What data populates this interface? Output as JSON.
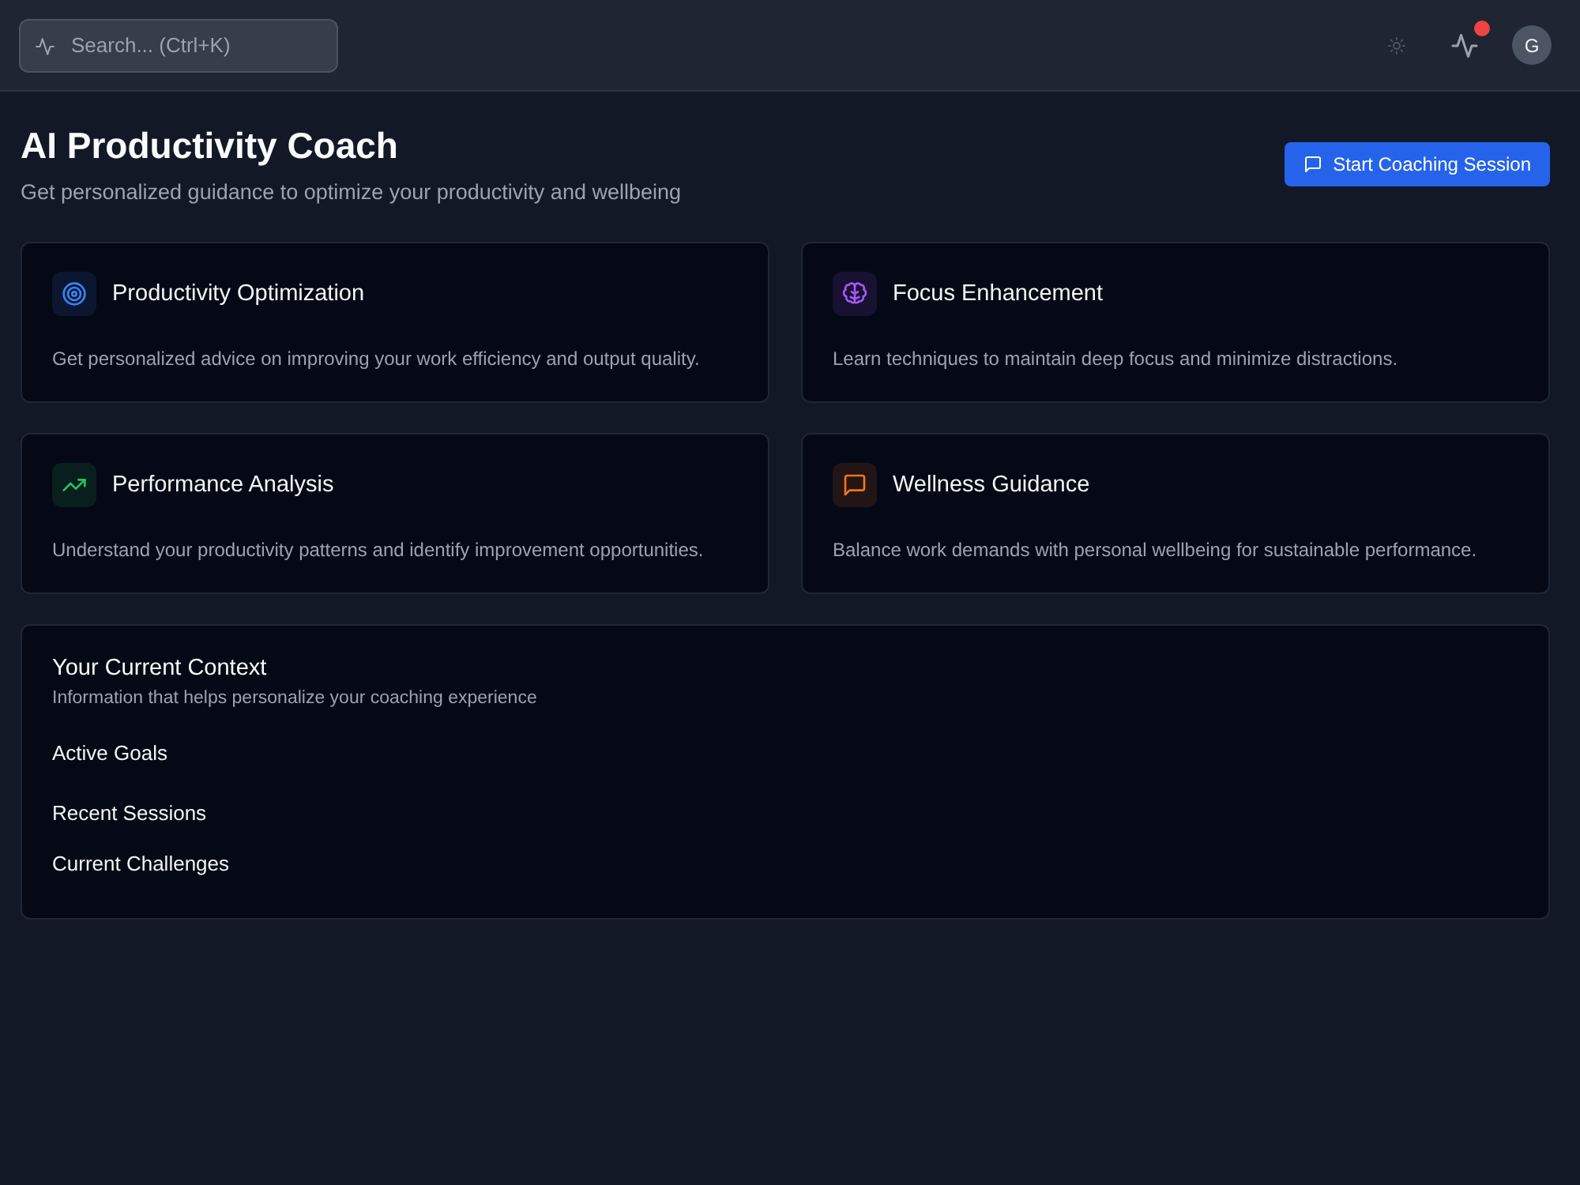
{
  "top_bar": {
    "search": {
      "placeholder": "Search... (Ctrl+K)"
    },
    "activity_alert": true,
    "avatar": {
      "initial": "G"
    }
  },
  "page": {
    "title": "AI Productivity Coach",
    "subtitle": "Get personalized guidance to optimize your productivity and wellbeing",
    "primary_button": "Start Coaching Session"
  },
  "features": [
    {
      "kind": "target",
      "color": "#3b82f6",
      "title": "Productivity Optimization",
      "description": "Get personalized advice on improving your work efficiency and output quality."
    },
    {
      "kind": "brain",
      "color": "#a855f7",
      "title": "Focus Enhancement",
      "description": "Learn techniques to maintain deep focus and minimize distractions."
    },
    {
      "kind": "trend",
      "color": "#22c55e",
      "title": "Performance Analysis",
      "description": "Understand your productivity patterns and identify improvement opportunities."
    },
    {
      "kind": "chat",
      "color": "#f97316",
      "title": "Wellness Guidance",
      "description": "Balance work demands with personal wellbeing for sustainable performance."
    }
  ],
  "context": {
    "title": "Your Current Context",
    "subtitle": "Information that helps personalize your coaching experience",
    "sections": [
      "Active Goals",
      "Recent Sessions",
      "Current Challenges"
    ]
  }
}
